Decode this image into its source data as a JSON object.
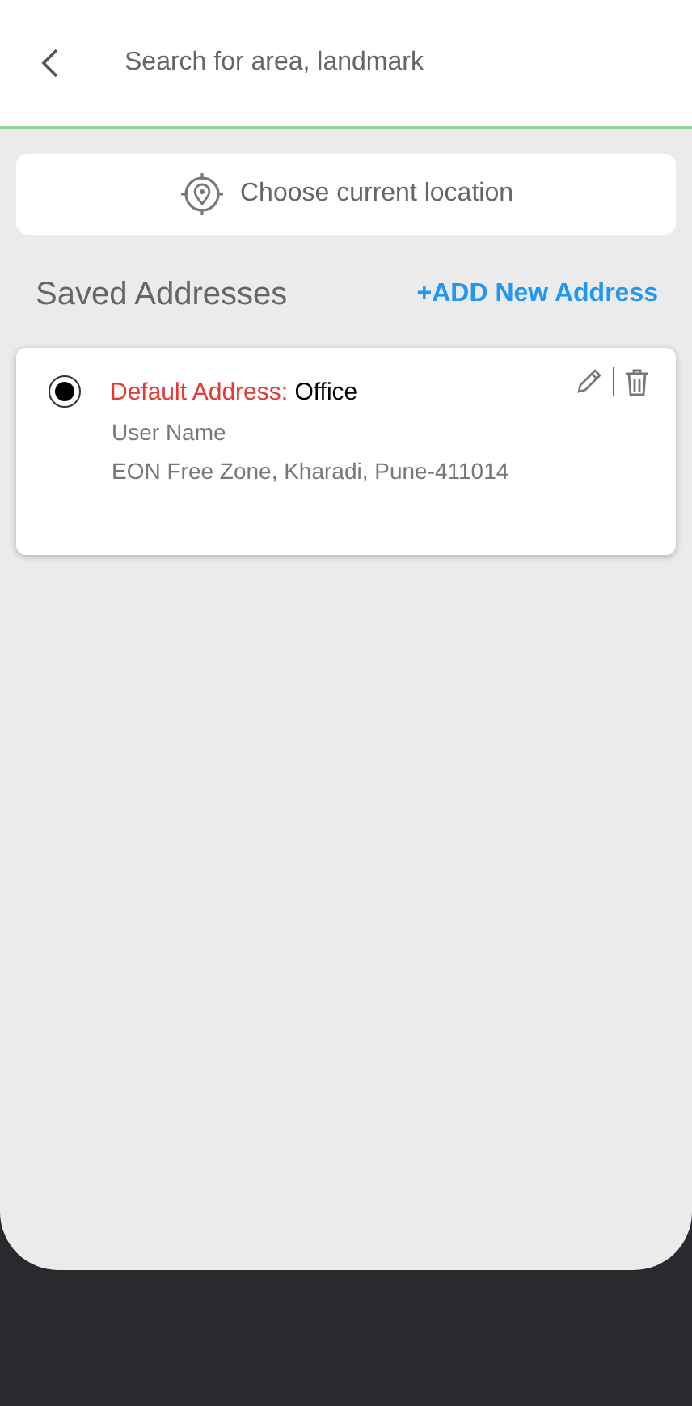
{
  "search": {
    "placeholder": "Search for area, landmark"
  },
  "current_location": {
    "label": "Choose current location"
  },
  "saved": {
    "title": "Saved Addresses",
    "add_link": "+ADD New Address"
  },
  "addresses": [
    {
      "selected": true,
      "default_label": "Default Address:",
      "type": "Office",
      "name": "User Name",
      "address": "EON Free Zone, Kharadi, Pune-411014"
    }
  ]
}
